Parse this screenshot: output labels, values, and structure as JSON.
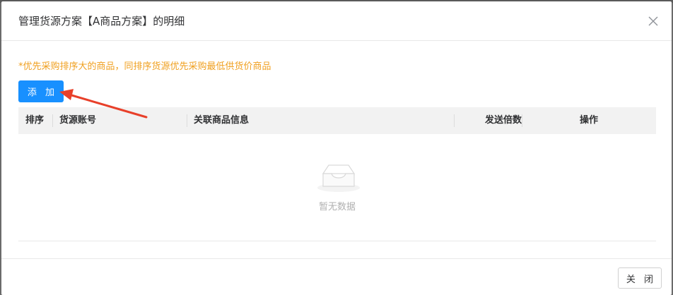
{
  "dialog": {
    "title": "管理货源方案【A商品方案】的明细",
    "close_icon": "close-icon"
  },
  "tip": "*优先采购排序大的商品，同排序货源优先采购最低供货价商品",
  "toolbar": {
    "add_label": "添 加"
  },
  "table": {
    "columns": [
      "排序",
      "货源账号",
      "关联商品信息",
      "发送倍数",
      "操作"
    ],
    "empty_text": "暂无数据",
    "empty_icon": "empty-inbox-icon"
  },
  "footer": {
    "close_label": "关 闭"
  },
  "colors": {
    "primary": "#1890ff",
    "tip": "#f0a020",
    "annotation_arrow": "#e8402a"
  }
}
